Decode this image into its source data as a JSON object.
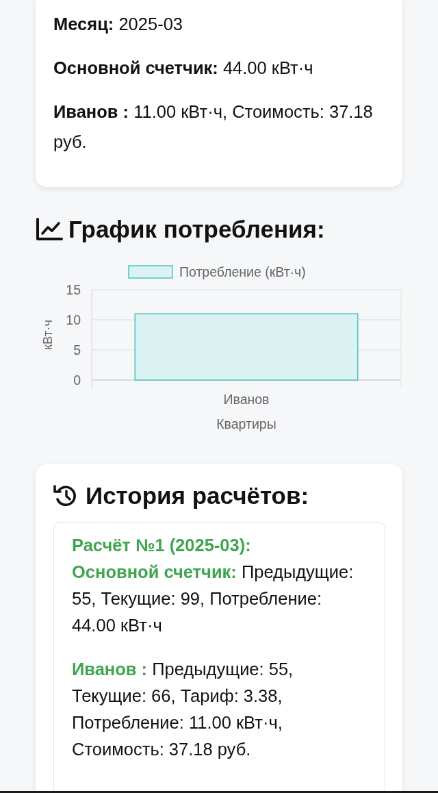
{
  "summary": {
    "lines": [
      "**Месяц:** 2025-03",
      "**Основной счетчик:** 44.00 кВт·ч",
      "**Иванов :** 11.00 кВт·ч, Стоимость: 37.18 руб."
    ]
  },
  "chart_section": {
    "title": "График потребления:",
    "chart_data": {
      "type": "bar",
      "xlabel": "Квартиры",
      "ylabel": "кВт·ч",
      "categories": [
        "Иванов"
      ],
      "series": [
        {
          "name": "Потребление (кВт·ч)",
          "color": "#4bc0c0",
          "values": [
            11
          ]
        }
      ],
      "ylim": [
        0,
        15
      ],
      "yticks": [
        0,
        5,
        10,
        15
      ]
    }
  },
  "history": {
    "title": "История расчётов:",
    "entries": [
      {
        "title": "Расчёт №1 (2025-03):",
        "lines": [
          "**Основной счетчик:** Предыдущие: 55, Текущие: 99, Потребление: 44.00 кВт·ч",
          "**Иванов :** Предыдущие: 55, Текущие: 66, Тариф: 3.38, Потребление: 11.00 кВт·ч, Стоимость: 37.18 руб."
        ]
      }
    ]
  }
}
